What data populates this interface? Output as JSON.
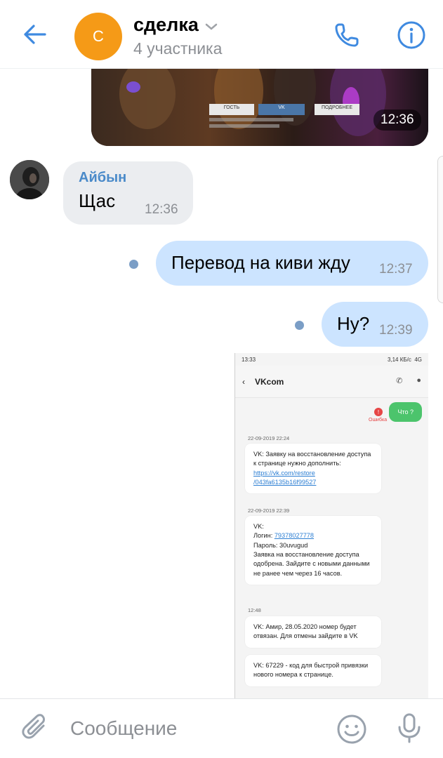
{
  "header": {
    "avatar_letter": "С",
    "title": "сделка",
    "subtitle": "4 участника",
    "icons": {
      "back": "arrow-left-icon",
      "call": "phone-icon",
      "info": "info-icon",
      "dropdown": "chevron-down-icon"
    }
  },
  "messages": {
    "image_top": {
      "time": "12:36",
      "overlay_buttons": [
        "ГОСТЬ",
        "VK",
        "ПОДРОБНЕЕ"
      ]
    },
    "incoming": {
      "sender": "Айбын",
      "text": "Щас",
      "time": "12:36"
    },
    "outgoing": [
      {
        "text": "Перевод на киви жду",
        "time": "12:37"
      },
      {
        "text": "Ну?",
        "time": "12:39"
      }
    ],
    "screenshot": {
      "status_time": "13:33",
      "status_right": "3,14 КБ/с",
      "status_network": "4G",
      "app_title": "VKcom",
      "sent_text": "Что ?",
      "error_label": "Ошибка",
      "sms": [
        {
          "date": "22-09-2019 22:24",
          "text": "VK: Заявку на восстановление доступа к странице нужно дополнить: ",
          "link": "https://vk.com/restore /043fa6135b16f99527"
        },
        {
          "date": "22-09-2019 22:39",
          "line1": "VK:",
          "line2_prefix": "Логин: ",
          "line2_link": "79378027778",
          "line3": "Пароль: 30uvugud",
          "line4": "Заявка на восстановление доступа одобрена. Зайдите с новыми данными не ранее чем через 16 часов."
        },
        {
          "date": "12:48",
          "text": "VK: Амир, 28.05.2020 номер будет отвязан. Для отмены зайдите в VK"
        },
        {
          "date": "",
          "text": "VK: 67229 - код для быстрой привязки нового номера к странице."
        }
      ]
    }
  },
  "composer": {
    "placeholder": "Сообщение",
    "icons": {
      "attach": "paperclip-icon",
      "emoji": "emoji-icon",
      "mic": "microphone-icon"
    }
  },
  "colors": {
    "accent": "#4a8ac9",
    "avatar_bg": "#f59a17",
    "outgoing_bubble": "#cce4ff",
    "incoming_bubble": "#ebedf0"
  }
}
